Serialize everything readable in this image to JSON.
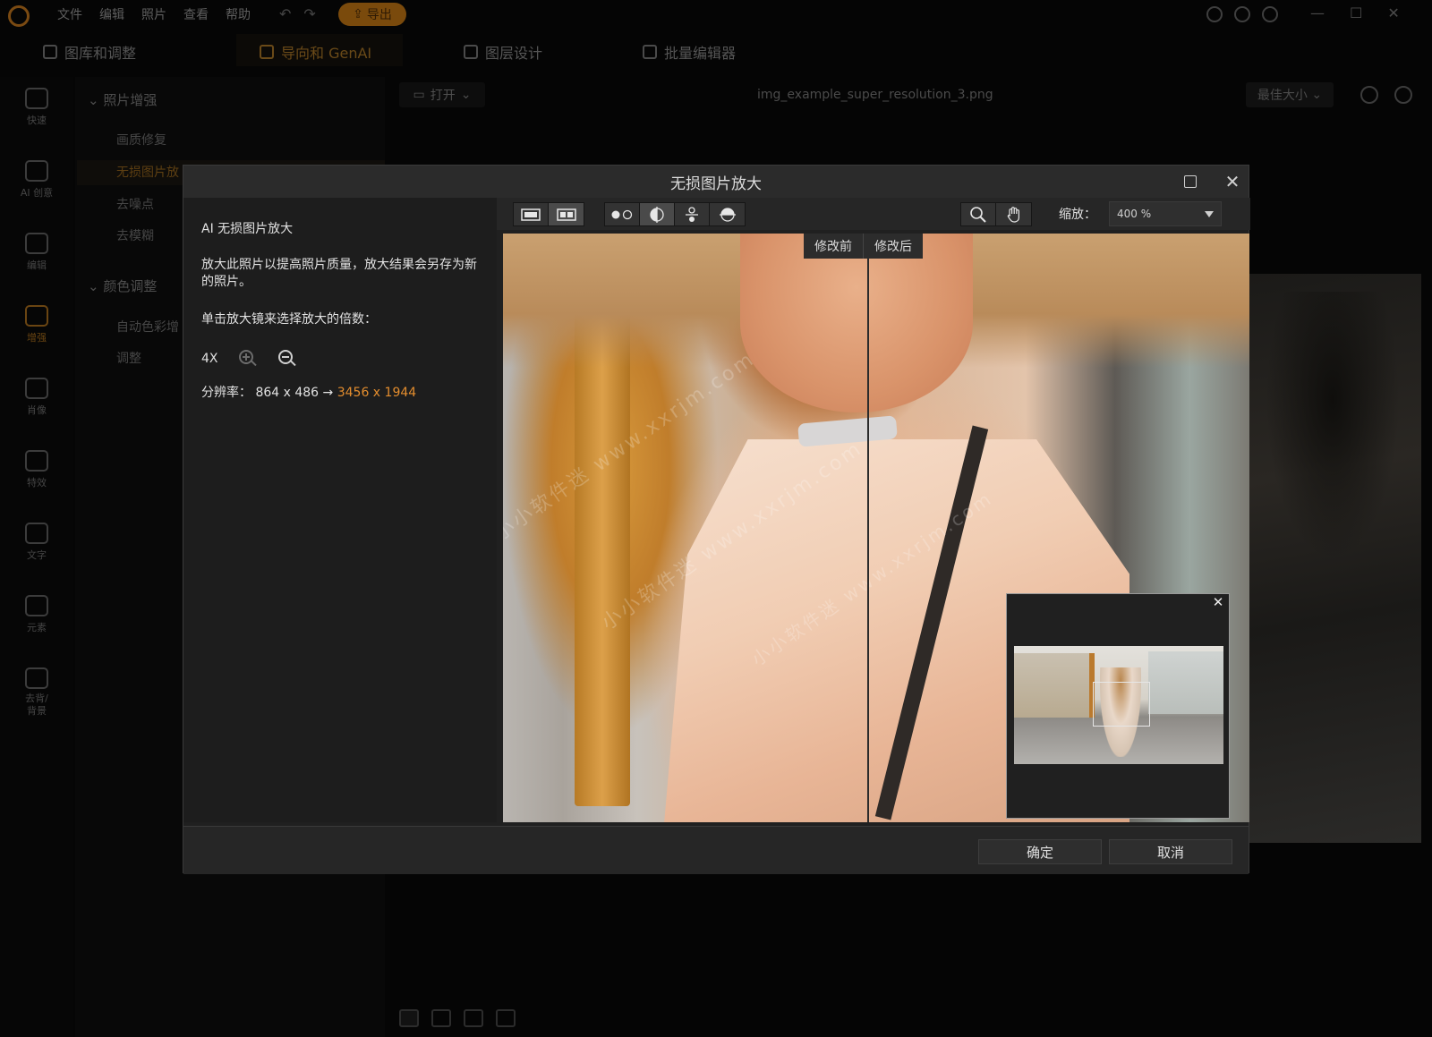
{
  "app": {
    "menu": [
      "文件",
      "编辑",
      "照片",
      "查看",
      "帮助"
    ],
    "export_label": "导出",
    "mode_tabs": [
      {
        "label": "图库和调整",
        "active": false
      },
      {
        "label": "导向和 GenAI",
        "active": true
      },
      {
        "label": "图层设计",
        "active": false
      },
      {
        "label": "批量编辑器",
        "active": false
      }
    ],
    "left_tools": [
      {
        "label": "快速",
        "icon": "quick-icon",
        "active": false
      },
      {
        "label": "AI 创意",
        "icon": "ai-creative-icon",
        "active": false
      },
      {
        "label": "编辑",
        "icon": "edit-icon",
        "active": false
      },
      {
        "label": "增强",
        "icon": "enhance-icon",
        "active": true
      },
      {
        "label": "肖像",
        "icon": "portrait-icon",
        "active": false
      },
      {
        "label": "特效",
        "icon": "effects-icon",
        "active": false
      },
      {
        "label": "文字",
        "icon": "text-icon",
        "active": false
      },
      {
        "label": "元素",
        "icon": "elements-icon",
        "active": false
      },
      {
        "label": "去背/\n背景",
        "icon": "background-icon",
        "active": false
      }
    ],
    "tree": {
      "section1": "照片增强",
      "items1": [
        "画质修复",
        "无损图片放",
        "去噪点",
        "去模糊"
      ],
      "section2": "颜色调整",
      "items2": [
        "自动色彩增",
        "调整"
      ]
    },
    "open_label": "打开",
    "filename": "img_example_super_resolution_3.png",
    "fit_label": "最佳大小"
  },
  "dialog": {
    "title": "无损图片放大",
    "heading": "AI 无损图片放大",
    "description": "放大此照片以提高照片质量，放大结果会另存为新的照片。",
    "instruction": "单击放大镜来选择放大的倍数：",
    "scale": "4X",
    "resolution_label": "分辨率：",
    "resolution_from": "864 x 486 →",
    "resolution_to": "3456 x 1944",
    "zoom_label": "缩放：",
    "zoom_value": "400 %",
    "before_label": "修改前",
    "after_label": "修改后",
    "ok_label": "确定",
    "cancel_label": "取消",
    "watermarks": [
      "小小软件迷 www.xxrjm.com",
      "小小软件迷 www.xxrjm.com",
      "小小软件迷 www.xxrjm.com"
    ]
  },
  "colors": {
    "accent": "#e38d2e",
    "dialog_bg": "#202020"
  }
}
